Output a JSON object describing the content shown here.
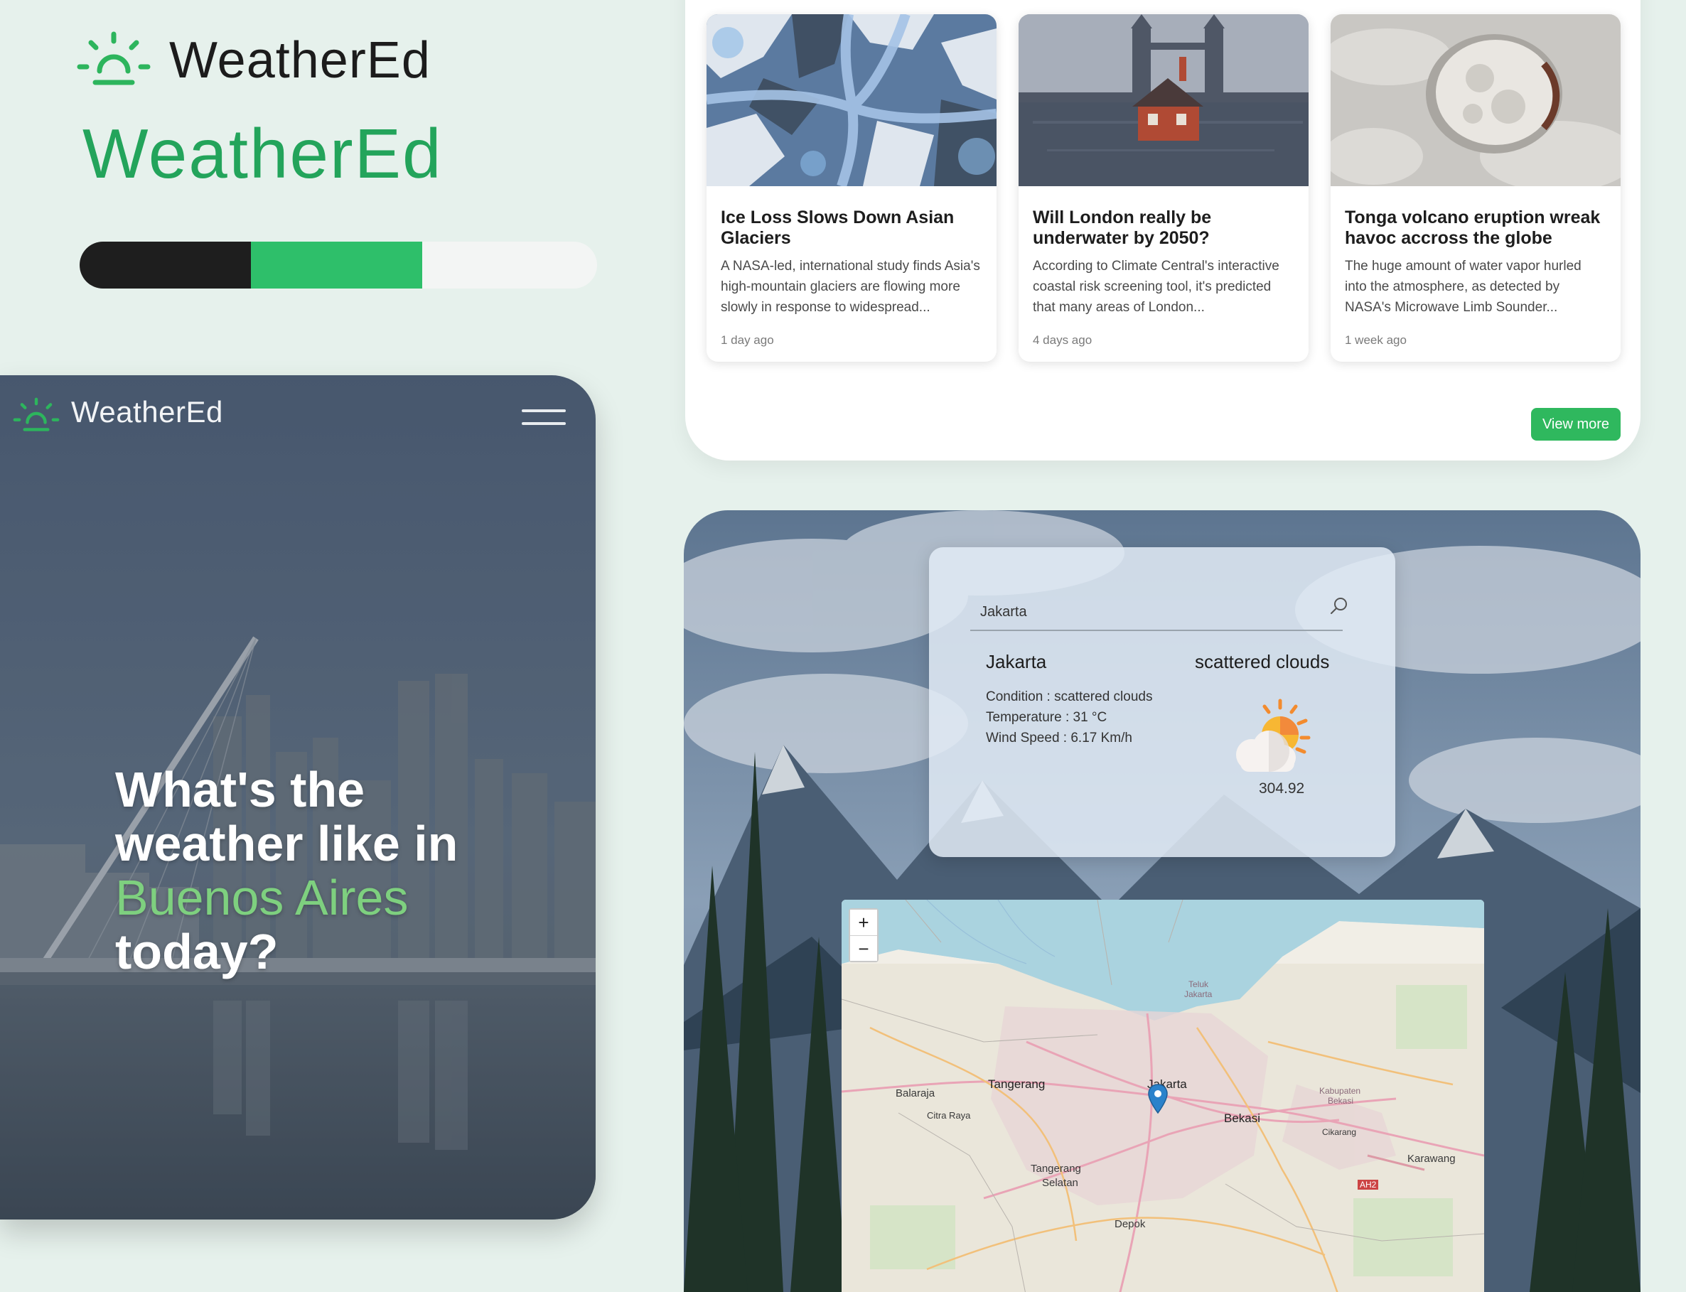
{
  "brand": {
    "wordmark": "WeatherEd",
    "wordmark_green": "WeatherEd",
    "colors": {
      "green": "#23a45b",
      "bar_dark": "#1e1e1e",
      "bar_green": "#2ebf6a",
      "bar_light": "#f3f5f4"
    }
  },
  "hero": {
    "nav_brand": "WeatherEd",
    "menu_icon": "hamburger-icon",
    "headline_line1": "What's the",
    "headline_line2": "weather like in",
    "headline_city": "Buenos Aires",
    "headline_line4": "today?"
  },
  "news": {
    "cards": [
      {
        "title": "Ice Loss Slows Down Asian Glaciers",
        "summary": "A NASA-led, international study finds Asia's high-mountain glaciers are flowing more slowly in response to widespread...",
        "ago": "1 day ago"
      },
      {
        "title": "Will London really be underwater by 2050?",
        "summary": "According to Climate Central's interactive coastal risk screening tool, it's predicted that many areas of London...",
        "ago": "4 days ago"
      },
      {
        "title": "Tonga volcano eruption wreak havoc accross the globe",
        "summary": "The huge amount of water vapor hurled into the atmosphere, as detected by NASA's Microwave Limb Sounder...",
        "ago": "1 week ago"
      }
    ],
    "view_more": "View more"
  },
  "weather": {
    "search_value": "Jakarta",
    "city": "Jakarta",
    "description": "scattered clouds",
    "condition": "Condition : scattered clouds",
    "temperature": "Temperature : 31 °C",
    "wind": "Wind Speed : 6.17 Km/h",
    "temp_value": "304.92",
    "icon": "partly-cloudy-icon"
  },
  "map": {
    "zoom_in": "+",
    "zoom_out": "−",
    "labels": {
      "tangerang": "Tangerang",
      "jakarta": "Jakarta",
      "bekasi": "Bekasi",
      "tangerang_selatan_1": "Tangerang",
      "tangerang_selatan_2": "Selatan",
      "depok": "Depok",
      "karawang": "Karawang",
      "balaraja": "Balaraja",
      "citra_raya": "Citra Raya",
      "kabupaten_1": "Kabupaten",
      "kabupaten_2": "Bekasi",
      "cikarang": "Cikarang",
      "teluk_1": "Teluk",
      "teluk_2": "Jakarta",
      "ah2": "AH2"
    }
  }
}
